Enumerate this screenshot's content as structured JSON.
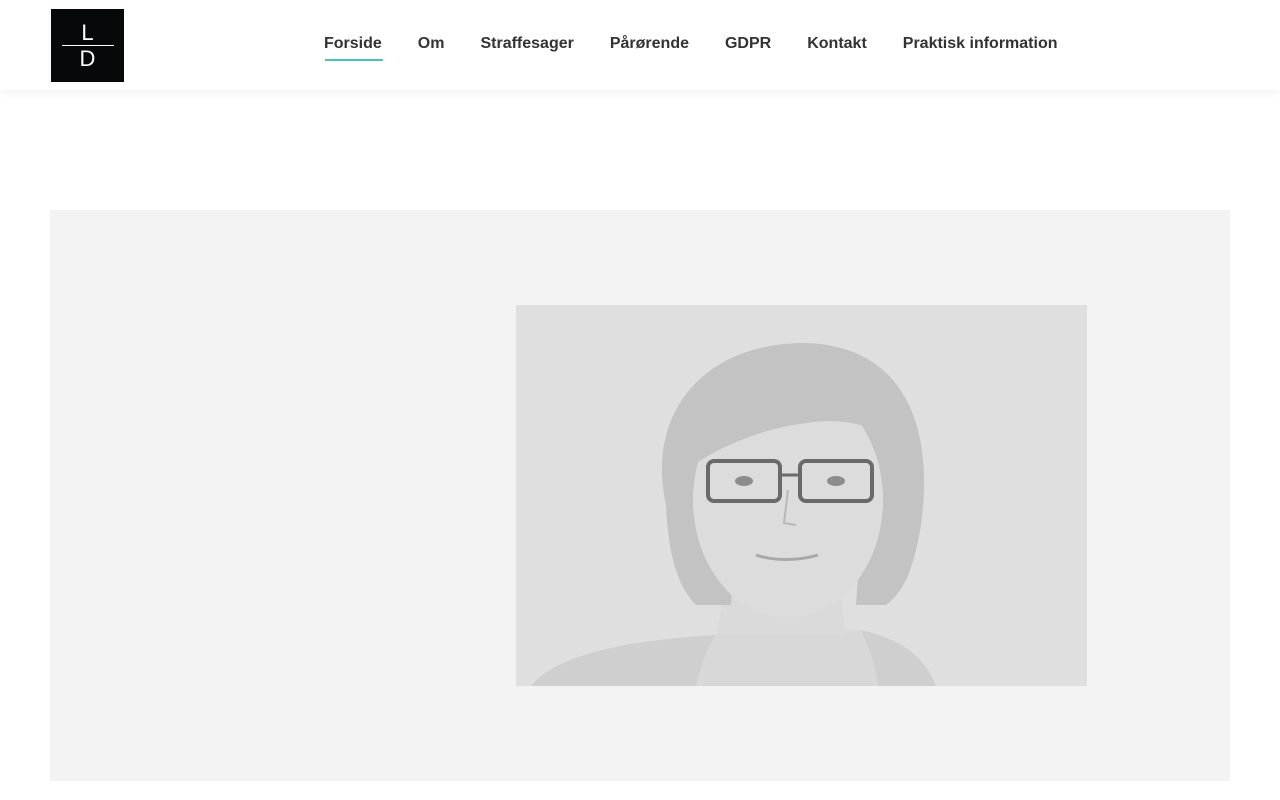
{
  "logo": {
    "letter_top": "L",
    "letter_bottom": "D"
  },
  "nav": {
    "items": [
      {
        "label": "Forside",
        "active": true
      },
      {
        "label": "Om",
        "active": false
      },
      {
        "label": "Straffesager",
        "active": false
      },
      {
        "label": "Pårørende",
        "active": false
      },
      {
        "label": "GDPR",
        "active": false
      },
      {
        "label": "Kontakt",
        "active": false
      },
      {
        "label": "Praktisk information",
        "active": false
      }
    ]
  },
  "colors": {
    "accent": "#4bc3b4",
    "logo_bg": "#060909",
    "nav_text": "#333333",
    "hero_bg": "#f3f3f3"
  }
}
